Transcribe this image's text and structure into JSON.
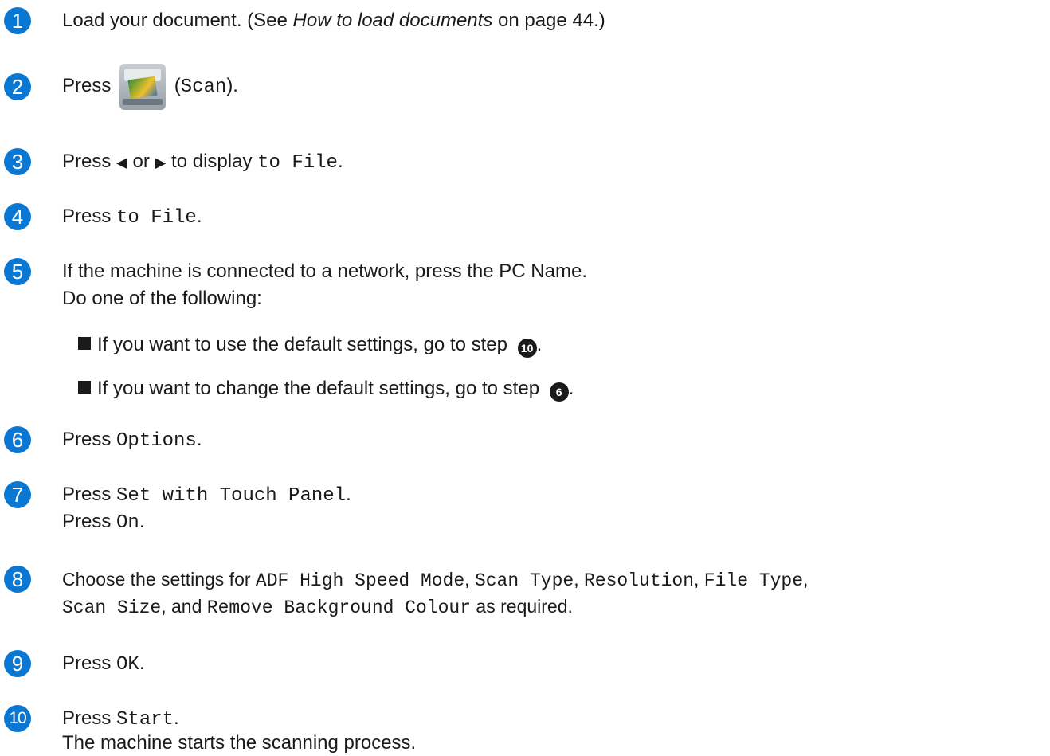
{
  "steps": [
    {
      "num": "1",
      "parts": [
        "Load your document. (See ",
        "How to load documents",
        " on page 44.)"
      ]
    },
    {
      "num": "2",
      "press": "Press",
      "open": "(",
      "code": "Scan",
      "close": ")."
    },
    {
      "num": "3",
      "a": "Press ",
      "left_arrow": "◀",
      "or": " or ",
      "right_arrow": "▶",
      "b": " to display ",
      "code": "to File",
      "end": "."
    },
    {
      "num": "4",
      "a": "Press ",
      "code": "to File",
      "end": "."
    },
    {
      "num": "5",
      "line1": "If the machine is connected to a network, press the PC Name.",
      "line2": "Do one of the following:",
      "bullets": [
        {
          "text": "If you want to use the default settings, go to step ",
          "ref": "10",
          "end": "."
        },
        {
          "text": "If you want to change the default settings, go to step ",
          "ref": "6",
          "end": "."
        }
      ]
    },
    {
      "num": "6",
      "a": "Press ",
      "code": "Options",
      "end": "."
    },
    {
      "num": "7",
      "a": "Press ",
      "code": "Set with Touch Panel",
      "end": ".",
      "b": "Press ",
      "code2": "On",
      "end2": "."
    },
    {
      "num": "8",
      "a": "Choose the settings for ",
      "c1": "ADF High Speed Mode",
      ",": ", ",
      "c2": "Scan Type",
      "c3": "Resolution",
      "c4": "File Type",
      "sep": ", ",
      "c5": "Scan Size",
      "and": ", and ",
      "c6": "Remove Background Colour",
      "tail": " as required."
    },
    {
      "num": "9",
      "a": "Press ",
      "code": "OK",
      "end": "."
    },
    {
      "num": "10",
      "a": "Press ",
      "code": "Start",
      "end": ".",
      "line2": "The machine starts the scanning process."
    }
  ]
}
